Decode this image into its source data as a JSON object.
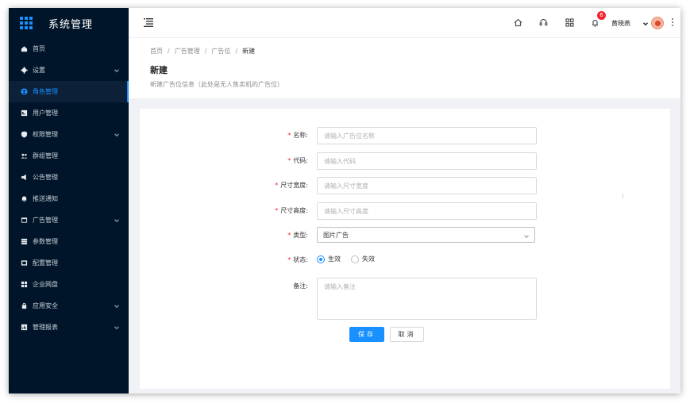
{
  "app": {
    "title": "系统管理"
  },
  "sidebar": {
    "items": [
      {
        "label": "首页",
        "icon": "home-icon",
        "has_children": false,
        "active": false
      },
      {
        "label": "设置",
        "icon": "gear-icon",
        "has_children": true,
        "active": false
      },
      {
        "label": "角色管理",
        "icon": "user-circle-icon",
        "has_children": false,
        "active": true
      },
      {
        "label": "用户管理",
        "icon": "id-card-icon",
        "has_children": false,
        "active": false
      },
      {
        "label": "权限管理",
        "icon": "shield-icon",
        "has_children": true,
        "active": false
      },
      {
        "label": "群组管理",
        "icon": "team-icon",
        "has_children": false,
        "active": false
      },
      {
        "label": "公告管理",
        "icon": "megaphone-icon",
        "has_children": false,
        "active": false
      },
      {
        "label": "推送通知",
        "icon": "bell-icon",
        "has_children": false,
        "active": false
      },
      {
        "label": "广告管理",
        "icon": "window-icon",
        "has_children": true,
        "active": false
      },
      {
        "label": "参数管理",
        "icon": "list-icon",
        "has_children": false,
        "active": false
      },
      {
        "label": "配置管理",
        "icon": "swap-icon",
        "has_children": false,
        "active": false
      },
      {
        "label": "企业网盘",
        "icon": "grid-icon",
        "has_children": false,
        "active": false
      },
      {
        "label": "应用安全",
        "icon": "lock-icon",
        "has_children": true,
        "active": false
      },
      {
        "label": "管理报表",
        "icon": "chart-icon",
        "has_children": true,
        "active": false
      }
    ]
  },
  "header": {
    "notification_count": "6",
    "user_name": "黄晓燕"
  },
  "breadcrumb": {
    "items": [
      "首页",
      "广告管理",
      "广告位"
    ],
    "current": "新建",
    "separator": "/"
  },
  "page": {
    "title": "新建",
    "description": "新建广告位信息（此处是无人售卖机的广告位）"
  },
  "form": {
    "name": {
      "label": "名称:",
      "placeholder": "请输入广告位名称",
      "required": true
    },
    "code": {
      "label": "代码:",
      "placeholder": "请输入代码",
      "required": true
    },
    "width": {
      "label": "尺寸宽度:",
      "placeholder": "请输入尺寸宽度",
      "required": true
    },
    "height": {
      "label": "尺寸高度:",
      "placeholder": "请输入尺寸高度",
      "required": true
    },
    "type": {
      "label": "类型:",
      "value": "图片广告",
      "required": true
    },
    "status": {
      "label": "状态:",
      "required": true,
      "options": [
        "生效",
        "失效"
      ],
      "selected": "生效"
    },
    "remark": {
      "label": "备注:",
      "placeholder": "请输入备注",
      "required": false
    },
    "save_label": "保存",
    "cancel_label": "取消"
  },
  "colors": {
    "sidebar_bg": "#001529",
    "primary": "#1890ff",
    "danger": "#f5222d"
  }
}
